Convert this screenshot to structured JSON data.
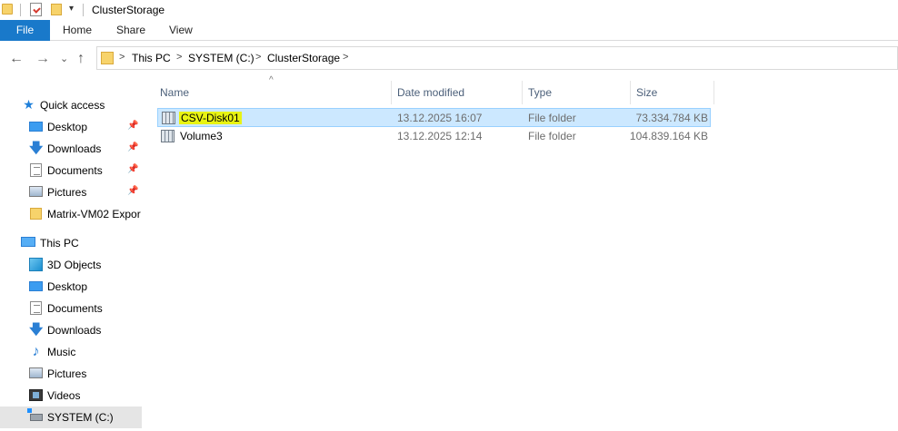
{
  "window": {
    "title": "ClusterStorage",
    "quick_access_dropdown": "▾"
  },
  "ribbon": {
    "file_label": "File",
    "tabs": [
      "Home",
      "Share",
      "View"
    ]
  },
  "nav": {
    "back": "←",
    "forward": "→",
    "recent": "⌄",
    "up": "↑"
  },
  "address": {
    "crumbs": [
      "This PC",
      "SYSTEM (C:)",
      "ClusterStorage"
    ],
    "sep": ">"
  },
  "navpane": {
    "quick_access": "Quick access",
    "quick_items": [
      {
        "label": "Desktop",
        "icon": "desktop-icon",
        "pinned": true
      },
      {
        "label": "Downloads",
        "icon": "downloads-icon",
        "pinned": true
      },
      {
        "label": "Documents",
        "icon": "documents-icon",
        "pinned": true
      },
      {
        "label": "Pictures",
        "icon": "pictures-icon",
        "pinned": true
      },
      {
        "label": "Matrix-VM02 Expor",
        "icon": "folder-icon",
        "pinned": false
      }
    ],
    "pin_glyph": "📌",
    "this_pc": "This PC",
    "pc_items": [
      {
        "label": "3D Objects",
        "icon": "3d-objects-icon"
      },
      {
        "label": "Desktop",
        "icon": "desktop-icon"
      },
      {
        "label": "Documents",
        "icon": "documents-icon"
      },
      {
        "label": "Downloads",
        "icon": "downloads-icon"
      },
      {
        "label": "Music",
        "icon": "music-icon"
      },
      {
        "label": "Pictures",
        "icon": "pictures-icon"
      },
      {
        "label": "Videos",
        "icon": "videos-icon"
      },
      {
        "label": "SYSTEM (C:)",
        "icon": "drive-icon"
      }
    ]
  },
  "filelist": {
    "sort_glyph": "^",
    "columns": [
      "Name",
      "Date modified",
      "Type",
      "Size"
    ],
    "rows": [
      {
        "name": "CSV-Disk01",
        "date": "13.12.2025 16:07",
        "type": "File folder",
        "size": "73.334.784 KB",
        "selected": true
      },
      {
        "name": "Volume3",
        "date": "13.12.2025 12:14",
        "type": "File folder",
        "size": "104.839.164 KB",
        "selected": false
      }
    ]
  },
  "colors": {
    "file_tab": "#1979ca",
    "selection": "#cce8ff",
    "highlight": "#e8f313"
  }
}
